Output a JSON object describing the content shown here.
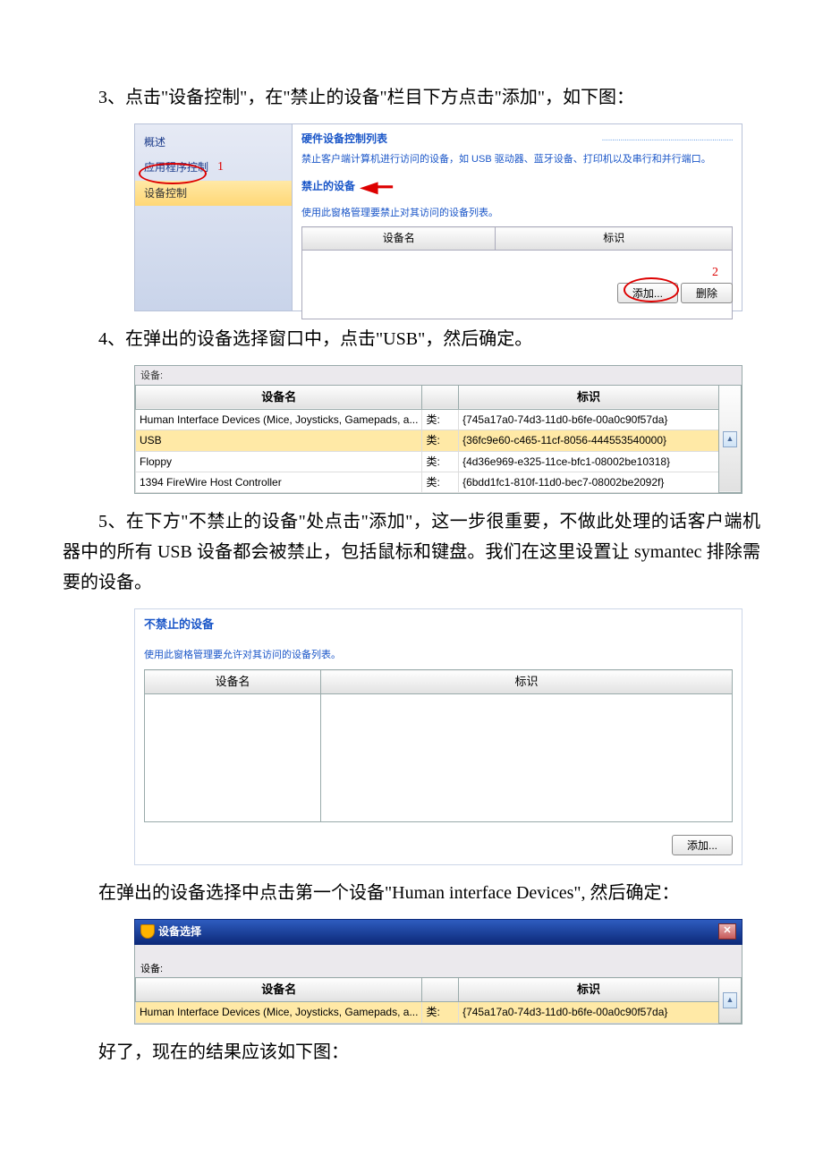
{
  "para3": "3、点击\"设备控制\"，在\"禁止的设备\"栏目下方点击\"添加\"，如下图：",
  "ss1": {
    "side": {
      "items": [
        "概述",
        "应用程序控制",
        "设备控制"
      ],
      "num1": "1"
    },
    "main": {
      "title": "硬件设备控制列表",
      "desc": "禁止客户端计算机进行访问的设备，如 USB 驱动器、蓝牙设备、打印机以及串行和并行端口。",
      "blocked_title": "禁止的设备",
      "hint": "使用此窗格管理要禁止对其访问的设备列表。",
      "th_name": "设备名",
      "th_id": "标识",
      "btn_add": "添加...",
      "btn_del": "删除",
      "num2": "2"
    }
  },
  "para4": "4、在弹出的设备选择窗口中，点击\"USB\"，然后确定。",
  "ss2": {
    "label": "设备:",
    "th_name": "设备名",
    "th_id": "标识",
    "type_label": "类:",
    "rows": [
      {
        "name": "Human Interface Devices (Mice, Joysticks, Gamepads, a...",
        "id": "{745a17a0-74d3-11d0-b6fe-00a0c90f57da}"
      },
      {
        "name": "USB",
        "id": "{36fc9e60-c465-11cf-8056-444553540000}"
      },
      {
        "name": "Floppy",
        "id": "{4d36e969-e325-11ce-bfc1-08002be10318}"
      },
      {
        "name": "1394 FireWire Host Controller",
        "id": "{6bdd1fc1-810f-11d0-bec7-08002be2092f}"
      }
    ]
  },
  "para5": "5、在下方\"不禁止的设备\"处点击\"添加\"，这一步很重要，不做此处理的话客户端机器中的所有 USB 设备都会被禁止，包括鼠标和键盘。我们在这里设置让 symantec 排除需要的设备。",
  "ss3": {
    "title": "不禁止的设备",
    "hint": "使用此窗格管理要允许对其访问的设备列表。",
    "th_name": "设备名",
    "th_id": "标识",
    "btn_add": "添加..."
  },
  "para6": "在弹出的设备选择中点击第一个设备\"Human interface Devices\", 然后确定：",
  "ss4": {
    "title": "设备选择",
    "label": "设备:",
    "th_name": "设备名",
    "th_id": "标识",
    "type_label": "类:",
    "row": {
      "name": "Human Interface Devices (Mice, Joysticks, Gamepads, a...",
      "id": "{745a17a0-74d3-11d0-b6fe-00a0c90f57da}"
    }
  },
  "para7": "好了，现在的结果应该如下图："
}
